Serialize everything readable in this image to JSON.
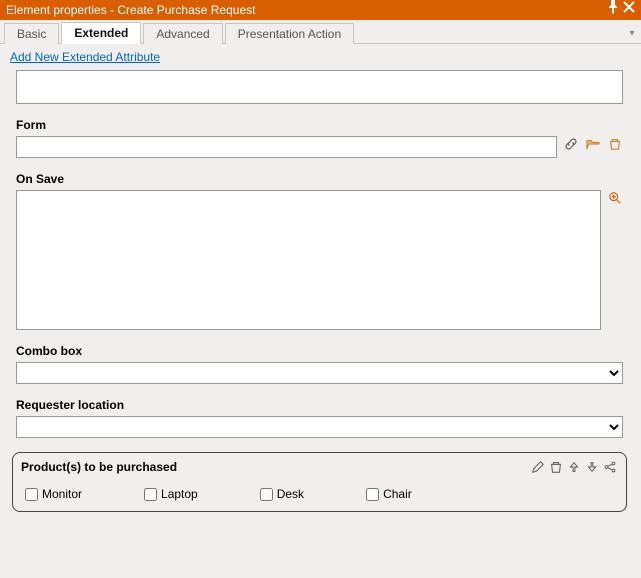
{
  "titlebar": {
    "title": "Element properties - Create Purchase Request"
  },
  "tabs": {
    "basic": "Basic",
    "extended": "Extended",
    "advanced": "Advanced",
    "presentation": "Presentation Action"
  },
  "link": {
    "add_attr": "Add New Extended Attribute"
  },
  "fields": {
    "form_label": "Form",
    "onsave_label": "On Save",
    "combo_label": "Combo box",
    "reqloc_label": "Requester location"
  },
  "products": {
    "title": "Product(s) to be purchased",
    "options": [
      "Monitor",
      "Laptop",
      "Desk",
      "Chair"
    ]
  }
}
